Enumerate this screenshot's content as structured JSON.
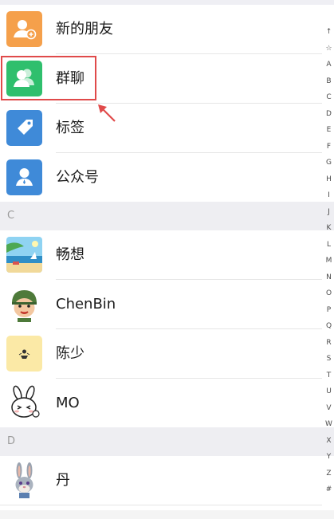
{
  "contacts": {
    "top_items": [
      {
        "label": "新的朋友",
        "icon": "new-friend-icon",
        "color": "#f5a04b"
      },
      {
        "label": "群聊",
        "icon": "group-chat-icon",
        "color": "#2fbf6d"
      },
      {
        "label": "标签",
        "icon": "tag-icon",
        "color": "#3f8ad8"
      },
      {
        "label": "公众号",
        "icon": "official-account-icon",
        "color": "#3f8ad8"
      }
    ],
    "sections": [
      {
        "letter": "C",
        "items": [
          {
            "name": "畅想",
            "avatar": "beach-avatar"
          },
          {
            "name": "ChenBin",
            "avatar": "soldier-avatar"
          },
          {
            "name": "陈少",
            "avatar": "yellow-figure-avatar"
          },
          {
            "name": "MO",
            "avatar": "rabbit-avatar"
          }
        ]
      },
      {
        "letter": "D",
        "items": [
          {
            "name": "丹",
            "avatar": "bunny-avatar"
          }
        ]
      }
    ]
  },
  "index_bar": [
    "↑",
    "☆",
    "A",
    "B",
    "C",
    "D",
    "E",
    "F",
    "G",
    "H",
    "I",
    "J",
    "K",
    "L",
    "M",
    "N",
    "O",
    "P",
    "Q",
    "R",
    "S",
    "T",
    "U",
    "V",
    "W",
    "X",
    "Y",
    "Z",
    "#"
  ],
  "highlight_color": "#e04a4a"
}
